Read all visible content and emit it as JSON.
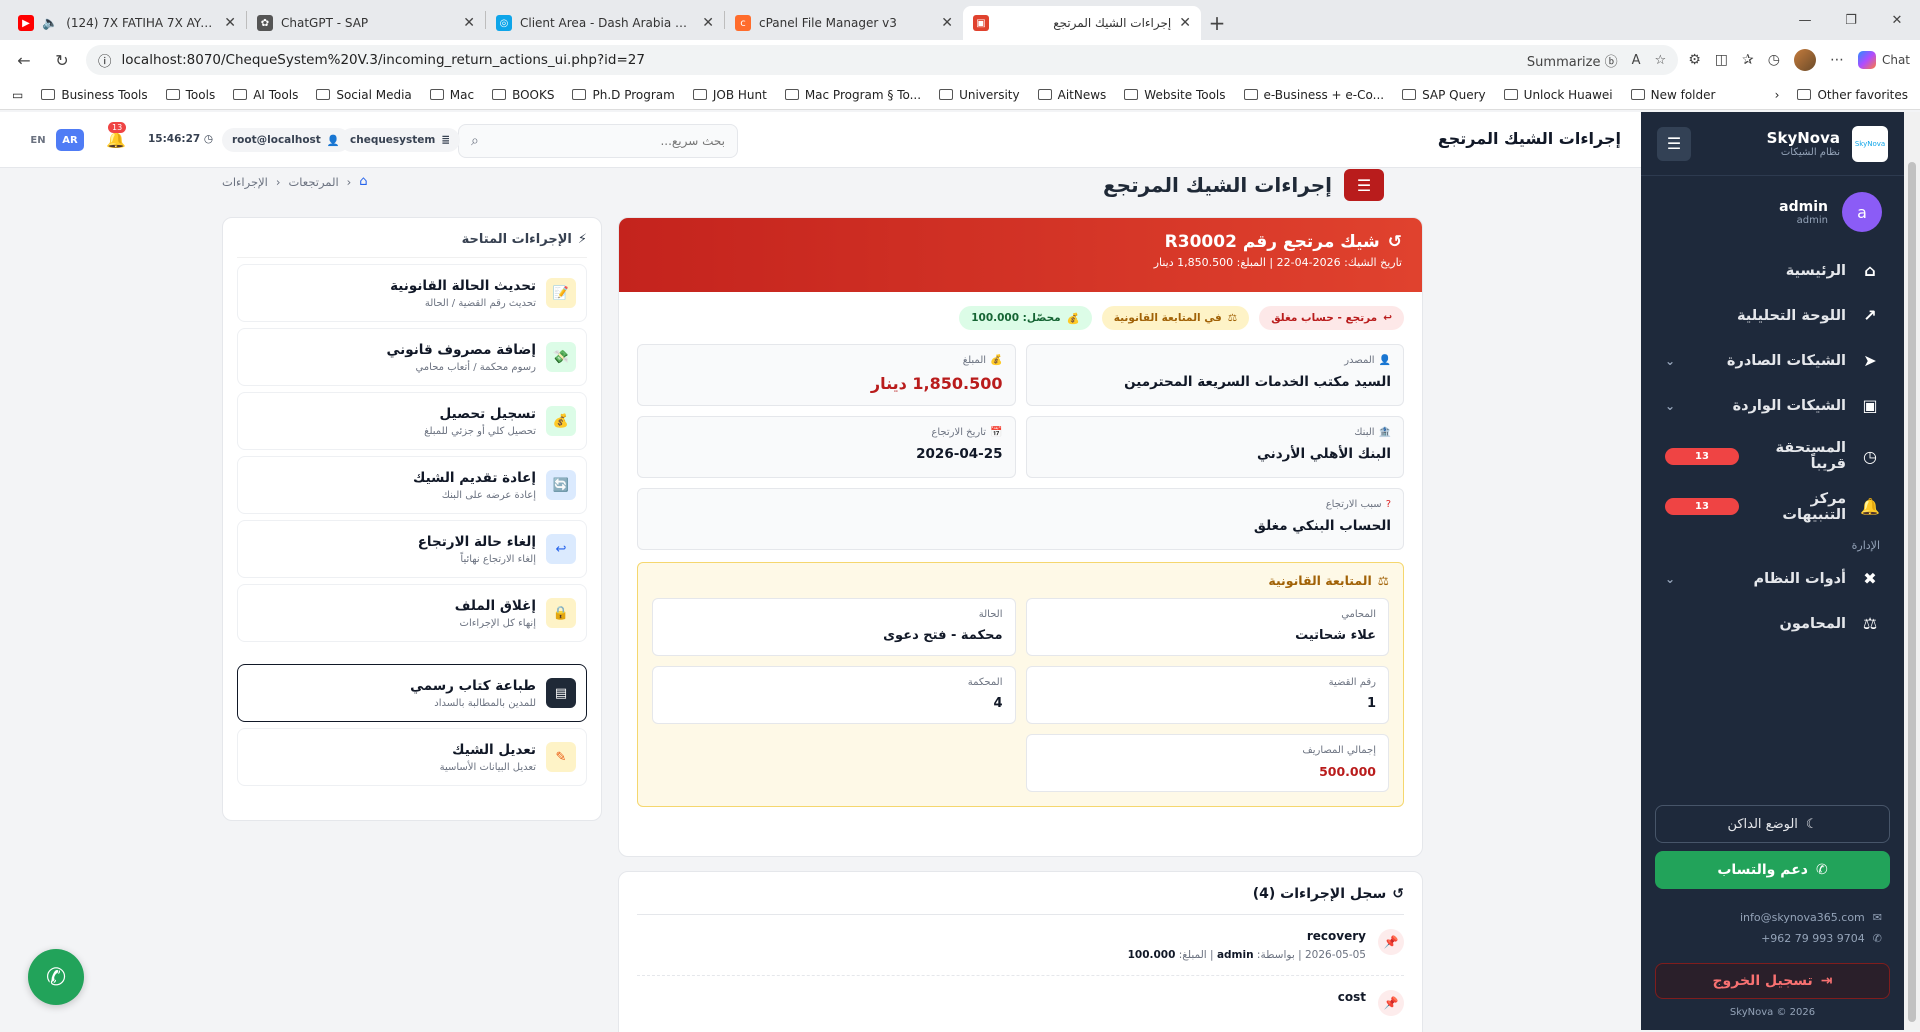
{
  "browser": {
    "tabs": [
      {
        "title": "(124) 7X FATIHA 7X AYATUL KURSI",
        "icon": "youtube-icon",
        "color": "#ff0000",
        "active": false,
        "rtl": false
      },
      {
        "title": "ChatGPT - SAP",
        "icon": "chatgpt-icon",
        "color": "#555555",
        "active": false,
        "rtl": false
      },
      {
        "title": "Client Area - Dash Arabia Cloud Se",
        "icon": "globe-icon",
        "color": "#0ea5e9",
        "active": false,
        "rtl": false
      },
      {
        "title": "cPanel File Manager v3",
        "icon": "cpanel-icon",
        "color": "#ff6c2c",
        "active": false,
        "rtl": false
      },
      {
        "title": "إجراءات الشيك المرتجع",
        "icon": "app-icon",
        "color": "#e0422e",
        "active": true,
        "rtl": true
      }
    ],
    "url": "localhost:8070/ChequeSystem%20V.3/incoming_return_actions_ui.php?id=27",
    "summarize": "Summarize",
    "chat": "Chat",
    "bookmarks": [
      "Business Tools",
      "Tools",
      "AI Tools",
      "Social Media",
      "Mac",
      "BOOKS",
      "Ph.D Program",
      "JOB Hunt",
      "Mac Program § To...",
      "University",
      "AitNews",
      "Website Tools",
      "e-Business + e-Co...",
      "SAP Query",
      "Unlock Huawei",
      "New folder"
    ],
    "other_favorites": "Other favorites"
  },
  "sidebar": {
    "brand": "SkyNova",
    "subtitle": "نظام الشيكات",
    "logo_text": "SkyNova",
    "user": {
      "initial": "a",
      "name": "admin",
      "role": "admin"
    },
    "nav": [
      {
        "label": "الرئيسية",
        "icon": "home-icon",
        "glyph": "⌂"
      },
      {
        "label": "اللوحة التحليلية",
        "icon": "chart-icon",
        "glyph": "📈"
      },
      {
        "label": "الشيكات الصادرة",
        "icon": "send-icon",
        "glyph": "➤",
        "chevron": true
      },
      {
        "label": "الشيكات الواردة",
        "icon": "inbox-icon",
        "glyph": "▣",
        "chevron": true
      }
    ],
    "due_soon": {
      "label": "المستحقة قريباً",
      "badge": "13"
    },
    "notifications": {
      "label": "مركز التنبيهات",
      "badge": "13"
    },
    "section_admin": "الإدارة",
    "system_tools": "أدوات النظام",
    "lawyers": "المحامون",
    "dark_mode": "الوضع الداكن",
    "whatsapp_support": "دعم والتساب",
    "email": "info@skynova365.com",
    "phone": "+962 79 993 9704",
    "logout": "تسجيل الخروج",
    "copyright": "SkyNova © 2026"
  },
  "topbar": {
    "title": "إجراءات الشيك المرتجع",
    "search_placeholder": "بحث سريع...",
    "system_chip": "chequesystem",
    "user_chip": "root@localhost",
    "time": "15:46:27",
    "notif_count": "13",
    "lang_ar": "AR",
    "lang_en": "EN"
  },
  "page": {
    "heading": "إجراءات الشيك المرتجع",
    "breadcrumb": [
      "المرتجعات",
      "الإجراءات"
    ]
  },
  "cheque": {
    "title": "شيك مرتجع رقم R30002",
    "subtitle": "تاريخ الشيك: 2026-04-22 | المبلغ: 1,850.500 دينار",
    "tags": [
      {
        "text": "مرتجع - حساب مغلق",
        "bg": "#fde8e8",
        "fg": "#b91c1c",
        "glyph": "↩"
      },
      {
        "text": "في المتابعة القانونية",
        "bg": "#fef3c7",
        "fg": "#a16207",
        "glyph": "⚖"
      },
      {
        "text": "محصّل: 100.000",
        "bg": "#dcfce7",
        "fg": "#166534",
        "glyph": "💰"
      }
    ],
    "source_label": "المصدر",
    "source_value": "السيد مكتب الخدمات السريعة المحترمين",
    "amount_label": "المبلغ",
    "amount_value": "1,850.500 دينار",
    "bank_label": "البنك",
    "bank_value": "البنك الأهلي الأردني",
    "return_date_label": "تاريخ الارتجاع",
    "return_date_value": "2026-04-25",
    "reason_label": "سبب الارتجاع",
    "reason_value": "الحساب البنكي مغلق"
  },
  "legal": {
    "title": "المتابعة القانونية",
    "lawyer_label": "المحامي",
    "lawyer_value": "علاء شحاتيت",
    "status_label": "الحالة",
    "status_value": "محكمة - فتح دعوى",
    "case_label": "رقم القضية",
    "case_value": "1",
    "court_label": "المحكمة",
    "court_value": "4",
    "costs_label": "إجمالي المصاريف",
    "costs_value": "500.000"
  },
  "log": {
    "title": "سجل الإجراءات (4)",
    "items": [
      {
        "action": "recovery",
        "date": "2026-05-05",
        "by_label": "بواسطة:",
        "user": "admin",
        "amount_label": "المبلغ:",
        "amount": "100.000"
      },
      {
        "action": "cost",
        "date": "",
        "by_label": "",
        "user": "",
        "amount_label": "",
        "amount": ""
      }
    ]
  },
  "actions": {
    "title": "الإجراءات المتاحة",
    "items": [
      {
        "title": "تحديث الحالة القانونية",
        "sub": "تحديث رقم القضية / الحالة",
        "icon": "note-icon",
        "glyph": "📝",
        "bg": "#fef3c7"
      },
      {
        "title": "إضافة مصروف قانوني",
        "sub": "رسوم محكمة / أتعاب محامي",
        "icon": "money-icon",
        "glyph": "💸",
        "bg": "#dcfce7"
      },
      {
        "title": "تسجيل تحصيل",
        "sub": "تحصيل كلي أو جزئي للمبلغ",
        "icon": "moneybag-icon",
        "glyph": "💰",
        "bg": "#dcfce7"
      },
      {
        "title": "إعادة تقديم الشيك",
        "sub": "إعادة عرضه على البنك",
        "icon": "resubmit-icon",
        "glyph": "🔄",
        "bg": "#dbeafe"
      },
      {
        "title": "إلغاء حالة الارتجاع",
        "sub": "إلغاء الارتجاع نهائياً",
        "icon": "undo-icon",
        "glyph": "↩",
        "bg": "#dbeafe"
      },
      {
        "title": "إغلاق الملف",
        "sub": "إنهاء كل الإجراءات",
        "icon": "lock-icon",
        "glyph": "🔒",
        "bg": "#fef3c7"
      }
    ],
    "print": {
      "title": "طباعة كتاب رسمي",
      "sub": "للمدين بالمطالبة بالسداد",
      "icon": "document-icon",
      "glyph": "▤"
    },
    "edit": {
      "title": "تعديل الشيك",
      "sub": "تعديل البيانات الأساسية",
      "icon": "pencil-icon",
      "glyph": "✎"
    }
  }
}
